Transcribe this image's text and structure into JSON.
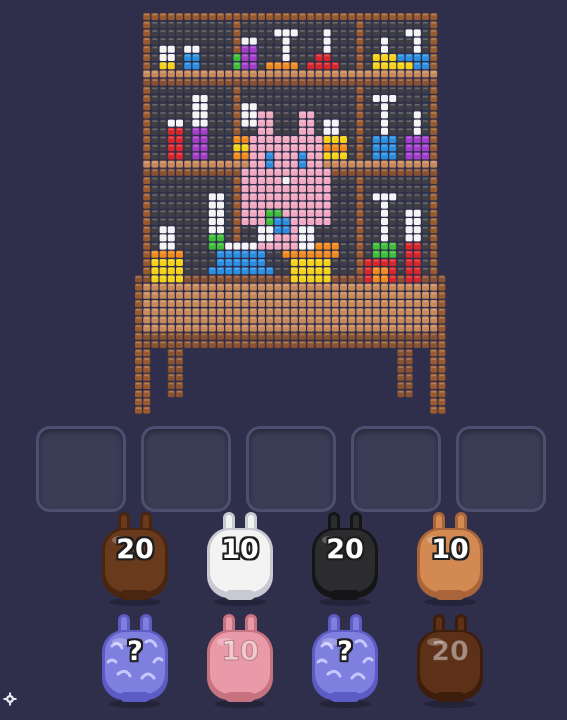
{
  "board": {
    "title": "",
    "palette": {
      "wood": "#c8895a",
      "wood_dark": "#8a5230",
      "frame": "#9a5a2e",
      "empty": "#3e3e44",
      "pink": "#f1a9c0",
      "white": "#f4f4f4",
      "yellow": "#f5d216",
      "orange": "#f08a1c",
      "red": "#d8262a",
      "blue": "#2a8fe0",
      "purple": "#a43dc8",
      "green": "#3fbe3a"
    }
  },
  "slots": [
    {
      "name": "slot-1"
    },
    {
      "name": "slot-2"
    },
    {
      "name": "slot-3"
    },
    {
      "name": "slot-4"
    },
    {
      "name": "slot-5"
    }
  ],
  "bunnies": [
    {
      "label": "20",
      "color": "#6a3a1c",
      "shade": "#4a2510",
      "active": true
    },
    {
      "label": "10",
      "color": "#f3f3f3",
      "shade": "#c9c9d2",
      "active": true
    },
    {
      "label": "20",
      "color": "#2c2c2e",
      "shade": "#151517",
      "active": true
    },
    {
      "label": "10",
      "color": "#d28a52",
      "shade": "#a9643a",
      "active": true
    },
    {
      "label": "?",
      "color": "#7f7fe0",
      "shade": "#5c5cc4",
      "active": true,
      "mystery": true
    },
    {
      "label": "10",
      "color": "#e89aa8",
      "shade": "#c7737f",
      "active": false
    },
    {
      "label": "?",
      "color": "#7f7fe0",
      "shade": "#5c5cc4",
      "active": true,
      "mystery": true
    },
    {
      "label": "20",
      "color": "#5c3118",
      "shade": "#3d1e0c",
      "active": false
    }
  ]
}
